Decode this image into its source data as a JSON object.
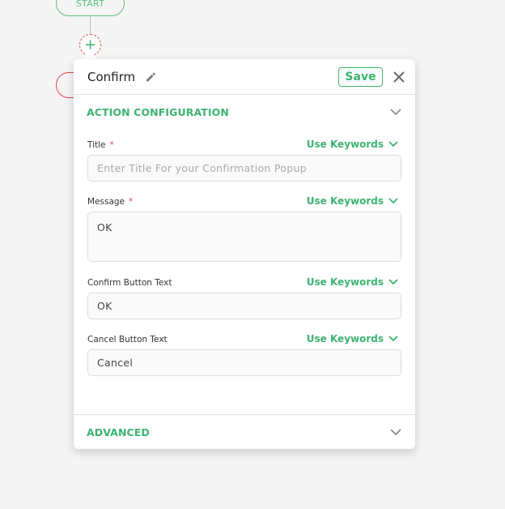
{
  "flow": {
    "start_label": "START",
    "add_icon": "plus-icon"
  },
  "panel": {
    "title": "Confirm",
    "edit_icon": "pencil-icon",
    "save_label": "Save",
    "close_icon": "close-icon",
    "sections": {
      "action_config": {
        "title": "ACTION CONFIGURATION",
        "expanded": true
      },
      "advanced": {
        "title": "ADVANCED",
        "expanded": false
      }
    },
    "fields": [
      {
        "label": "Title",
        "required": true,
        "keyword_label": "Use Keywords",
        "value": "",
        "placeholder": "Enter Title For your Confirmation Popup"
      },
      {
        "label": "Message",
        "required": true,
        "keyword_label": "Use Keywords",
        "value": "OK",
        "placeholder": ""
      },
      {
        "label": "Confirm Button Text",
        "required": false,
        "keyword_label": "Use Keywords",
        "value": "OK",
        "placeholder": ""
      },
      {
        "label": "Cancel Button Text",
        "required": false,
        "keyword_label": "Use Keywords",
        "value": "Cancel",
        "placeholder": ""
      }
    ],
    "required_marker": "*"
  },
  "colors": {
    "accent": "#3cb371",
    "required": "#e04848",
    "node_red": "#d84a4a"
  }
}
